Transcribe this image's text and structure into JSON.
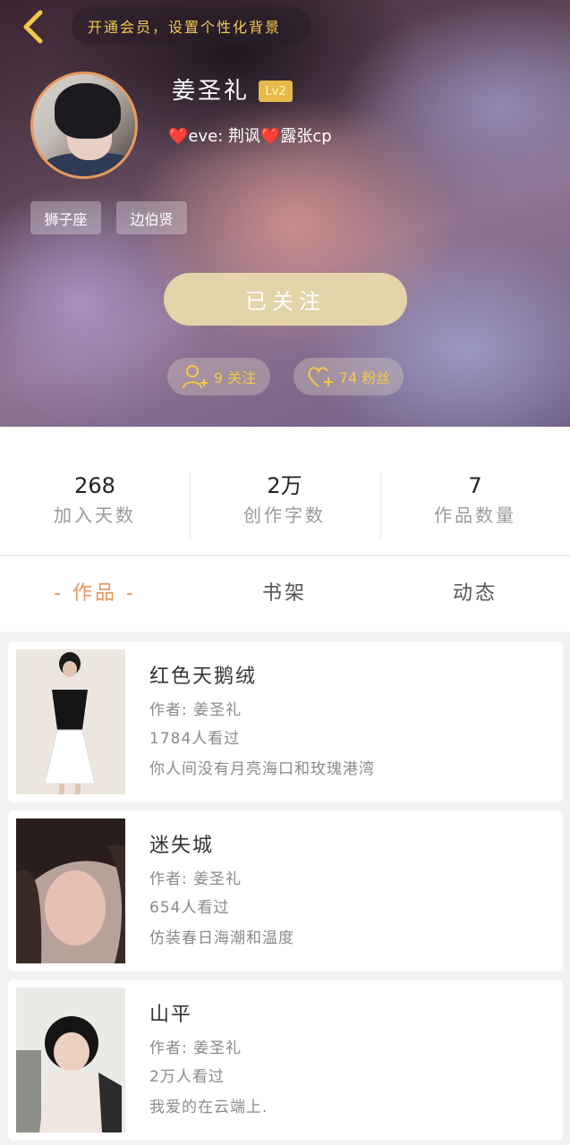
{
  "header": {
    "vip_banner": "开通会员，设置个性化背景",
    "username": "姜圣礼",
    "level": "Lv2",
    "signature": "❤️eve: 荆讽❤️露张cp",
    "tags": [
      "狮子座",
      "边伯贤"
    ],
    "follow_button": "已关注",
    "following": "9 关注",
    "followers": "74 粉丝",
    "colors": {
      "accent": "#e6955e",
      "gold": "#f2c94c",
      "follow_bg": "#e3d4a9"
    }
  },
  "stats": [
    {
      "value": "268",
      "label": "加入天数"
    },
    {
      "value": "2万",
      "label": "创作字数"
    },
    {
      "value": "7",
      "label": "作品数量"
    }
  ],
  "tabs": [
    {
      "label": "- 作品 -",
      "active": true
    },
    {
      "label": "书架",
      "active": false
    },
    {
      "label": "动态",
      "active": false
    }
  ],
  "works": [
    {
      "title": "红色天鹅绒",
      "author": "作者: 姜圣礼",
      "views": "1784人看过",
      "desc": "你人间没有月亮海口和玫瑰港湾"
    },
    {
      "title": "迷失城",
      "author": "作者: 姜圣礼",
      "views": "654人看过",
      "desc": "仿装春日海潮和温度"
    },
    {
      "title": "山平",
      "author": "作者: 姜圣礼",
      "views": "2万人看过",
      "desc": "我爱的在云端上."
    }
  ],
  "icons": {
    "back": "chevron-left-icon",
    "following": "user-plus-icon",
    "followers": "heart-plus-icon"
  }
}
